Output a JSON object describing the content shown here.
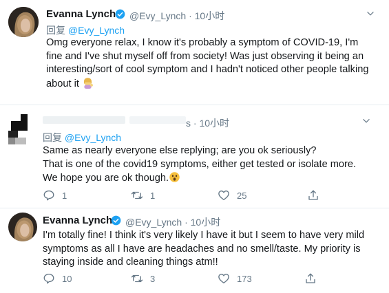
{
  "tweet1": {
    "name": "Evanna Lynch",
    "handle": "@Evy_Lynch",
    "time": "10小时",
    "reply_prefix": "回复",
    "reply_handle": "@Evy_Lynch",
    "text": "Omg everyone relax, I know it's probably a symptom of COVID-19, I'm fine and I've shut myself off from society! Was just observing it being an interesting/sort of cool symptom and I hadn't noticed other people talking about it",
    "emoji": "woman-tipping-hand"
  },
  "tweet2": {
    "time_suffix": "s · 10小时",
    "reply_prefix": "回复",
    "reply_handle": "@Evy_Lynch",
    "line1": "Same as nearly everyone else replying; are you ok seriously?",
    "line2": "That is one of the covid19 symptoms, either get tested or isolate more.",
    "line3": "We hope you are ok though.",
    "emoji": "astonished-face",
    "replies": "1",
    "retweets": "1",
    "likes": "25"
  },
  "tweet3": {
    "name": "Evanna Lynch",
    "handle": "@Evy_Lynch",
    "time": "10小时",
    "text": "I'm totally fine! I think it's very likely I have it but I seem to have very mild symptoms as all I have are headaches and no smell/taste. My priority is staying inside and cleaning things atm!!",
    "replies": "10",
    "retweets": "3",
    "likes": "173"
  },
  "colors": {
    "accent": "#1da1f2",
    "muted": "#657786",
    "text": "#14171a",
    "separator": "#e6ecf0"
  },
  "icons": [
    "verified-badge-icon",
    "chevron-down-icon",
    "reply-icon",
    "retweet-icon",
    "like-icon",
    "share-icon"
  ]
}
